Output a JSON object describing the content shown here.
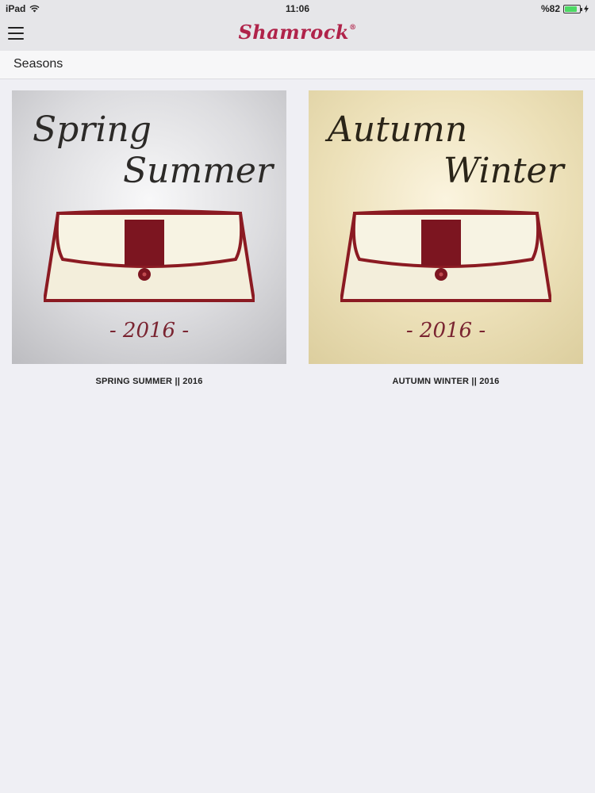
{
  "status_bar": {
    "device": "iPad",
    "time": "11:06",
    "battery": "%82",
    "battery_level": 0.82
  },
  "navbar": {
    "brand": "Shamrock",
    "brand_mark": "®"
  },
  "section": {
    "title": "Seasons"
  },
  "collections": [
    {
      "line1": "Spring",
      "line2": "Summer",
      "year": "- 2016 -",
      "caption": "SPRING SUMMER || 2016"
    },
    {
      "line1": "Autumn",
      "line2": "Winter",
      "year": "- 2016 -",
      "caption": "AUTUMN WINTER || 2016"
    }
  ],
  "colors": {
    "brand": "#b0234a",
    "bag_trim": "#8b1a22",
    "bag_body": "#f3eedb"
  }
}
